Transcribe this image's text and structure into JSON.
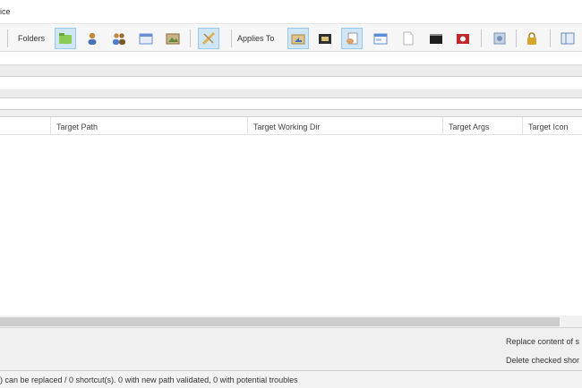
{
  "window": {
    "title_fragment": "ice"
  },
  "toolbar": {
    "folders_label": "Folders",
    "applies_to_label": "Applies To",
    "folder_buttons": [
      {
        "icon": "green-folder-icon",
        "color": "#7fbf4a",
        "active": true
      },
      {
        "icon": "single-user-icon",
        "color": "#c08a3e",
        "active": false
      },
      {
        "icon": "users-group-icon",
        "color": "#4f7fcf",
        "active": false
      },
      {
        "icon": "window-folder-icon",
        "color": "#6b8fd4",
        "active": false
      },
      {
        "icon": "pictures-folder-icon",
        "color": "#8b6a3f",
        "active": false
      }
    ],
    "tool_button": {
      "icon": "wrench-pencil-icon",
      "color": "#e0b25a",
      "active": true
    },
    "applies_buttons": [
      {
        "icon": "shortcut-folder-icon",
        "color": "#c9a35c",
        "active": true
      },
      {
        "icon": "terminal-icon",
        "color": "#2f2f2f",
        "active": false
      },
      {
        "icon": "hand-document-icon",
        "color": "#d9a06a",
        "active": true
      },
      {
        "icon": "window-icon",
        "color": "#5a8ed6",
        "active": false
      },
      {
        "icon": "blank-document-icon",
        "color": "#e6e6e6",
        "active": false
      },
      {
        "icon": "console-icon",
        "color": "#1f1f1f",
        "active": false
      },
      {
        "icon": "record-icon",
        "color": "#c0282a",
        "active": false
      }
    ],
    "extra_buttons": [
      {
        "icon": "drive-icon",
        "color": "#7a93b8",
        "active": false
      },
      {
        "icon": "lock-icon",
        "color": "#d7a72b",
        "active": false
      },
      {
        "icon": "panel-icon",
        "color": "#6b89b4",
        "active": false
      }
    ]
  },
  "grid": {
    "columns": [
      "",
      "Target Path",
      "Target Working Dir",
      "Target Args",
      "Target Icon"
    ]
  },
  "bottom": {
    "replace_label": "Replace content of s",
    "delete_label": "Delete checked shor"
  },
  "status": {
    "text": ") can be replaced / 0 shortcut(s). 0 with new path validated, 0 with potential troubles"
  }
}
